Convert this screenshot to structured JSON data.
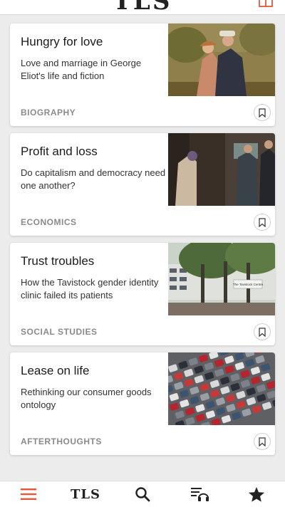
{
  "header": {
    "logo": "TLS",
    "icon": "gift-icon"
  },
  "articles": [
    {
      "title": "Hungry for love",
      "description": "Love and marriage in George Eliot's life and fiction",
      "category": "BIOGRAPHY",
      "image": "painting-couple"
    },
    {
      "title": "Profit and loss",
      "description": "Do capitalism and democracy need one another?",
      "category": "ECONOMICS",
      "image": "men-at-cash-machine"
    },
    {
      "title": "Trust troubles",
      "description": "How the Tavistock gender identity clinic failed its patients",
      "category": "SOCIAL STUDIES",
      "image": "tavistock-building-trees",
      "image_sign": "The Tavistock Centre"
    },
    {
      "title": "Lease on life",
      "description": "Rethinking our consumer goods ontology",
      "category": "AFTERTHOUGHTS",
      "image": "car-park"
    }
  ],
  "tabbar": {
    "items": [
      {
        "name": "menu",
        "icon": "menu-icon",
        "active": true
      },
      {
        "name": "home",
        "label": "TLS"
      },
      {
        "name": "search",
        "icon": "search-icon"
      },
      {
        "name": "audio",
        "icon": "playlist-headphones-icon"
      },
      {
        "name": "favourites",
        "icon": "star-icon"
      }
    ]
  },
  "colors": {
    "accent": "#e8563a",
    "background": "#ececec",
    "card": "#ffffff",
    "category_text": "#8a8a8a",
    "title_text": "#1b1b1b"
  }
}
